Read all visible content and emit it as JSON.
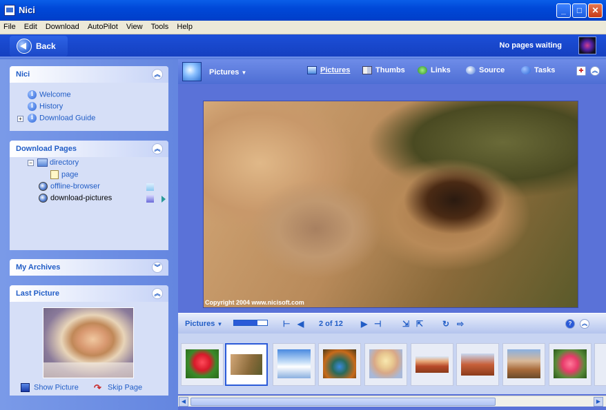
{
  "window": {
    "title": "Nici"
  },
  "menu": [
    "File",
    "Edit",
    "Download",
    "AutoPilot",
    "View",
    "Tools",
    "Help"
  ],
  "toolbar": {
    "back_label": "Back",
    "status": "No pages waiting"
  },
  "sidebar": {
    "nici": {
      "title": "Nici",
      "items": [
        "Welcome",
        "History",
        "Download Guide"
      ]
    },
    "download_pages": {
      "title": "Download Pages",
      "items": [
        "directory",
        "page",
        "offline-browser",
        "download-pictures"
      ]
    },
    "archives": {
      "title": "My Archives"
    },
    "last_picture": {
      "title": "Last Picture",
      "show_label": "Show Picture",
      "skip_label": "Skip Page"
    }
  },
  "main": {
    "view_label": "Pictures",
    "tabs": [
      "Pictures",
      "Thumbs",
      "Links",
      "Source",
      "Tasks"
    ],
    "copyright": "Copyright 2004 www.nicisoft.com",
    "filmstrip": {
      "label": "Pictures",
      "counter": "2 of 12",
      "progress_percent": 70
    }
  },
  "colors": {
    "titlebar": "#0a5ee8",
    "panel_title": "#215dc6",
    "accent": "#2a5ad8"
  },
  "thumbnail_subjects": [
    "red-flower",
    "lion-cubs",
    "sky-clouds",
    "peacock",
    "portrait",
    "red-rock",
    "desert-canyon",
    "canyon-landscape",
    "pink-flower"
  ]
}
